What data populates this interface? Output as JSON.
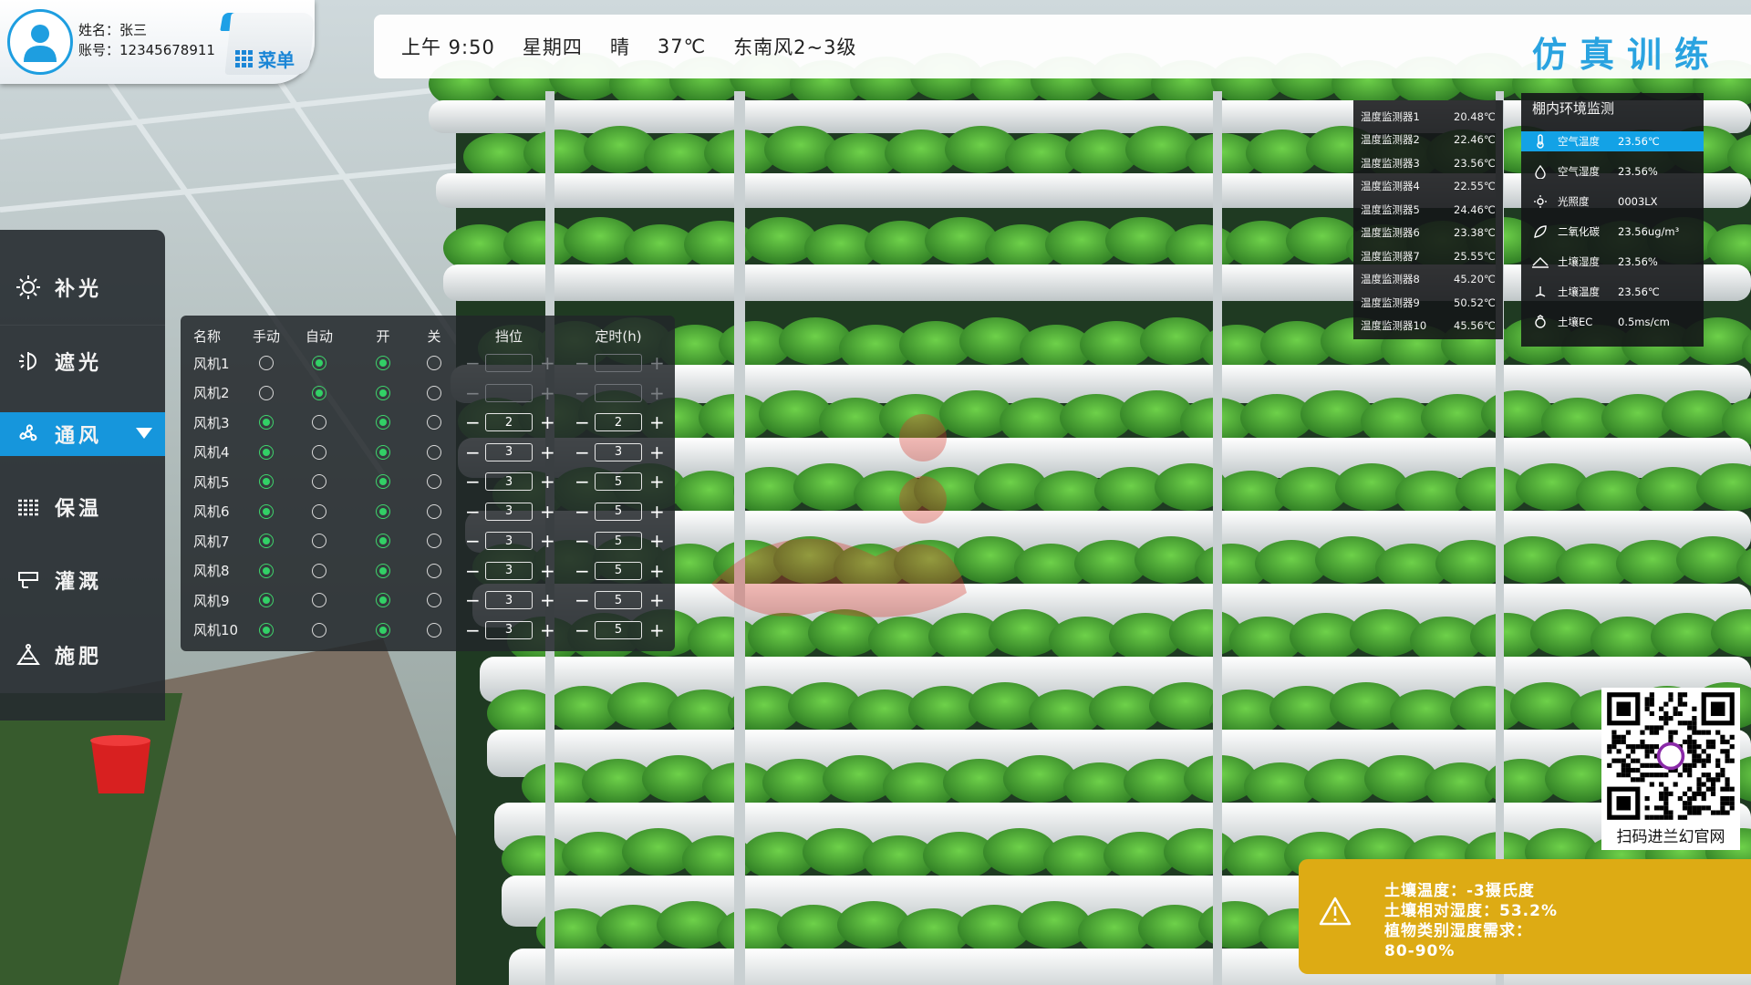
{
  "user": {
    "name_line": "姓名：张三",
    "account_line": "账号：12345678911"
  },
  "menu_label": "菜单",
  "status": {
    "time": "上午 9:50",
    "weekday": "星期四",
    "weather": "晴",
    "temperature": "37℃",
    "wind": "东南风2~3级",
    "mode_title": "仿真训练"
  },
  "nav": {
    "items": [
      {
        "label": "补光",
        "icon": "sun-icon"
      },
      {
        "label": "遮光",
        "icon": "shade-icon"
      },
      {
        "label": "通风",
        "icon": "fan-icon",
        "active": true
      },
      {
        "label": "保温",
        "icon": "insulation-icon"
      },
      {
        "label": "灌溉",
        "icon": "irrigation-icon"
      },
      {
        "label": "施肥",
        "icon": "fertilize-icon"
      }
    ]
  },
  "fan_table": {
    "headers": {
      "name": "名称",
      "manual": "手动",
      "auto": "自动",
      "on": "开",
      "off": "关",
      "gear": "挡位",
      "timer": "定时(h)"
    },
    "rows": [
      {
        "name": "风机1",
        "mode": "auto",
        "power": "on",
        "gear": "",
        "timer": ""
      },
      {
        "name": "风机2",
        "mode": "auto",
        "power": "on",
        "gear": "",
        "timer": ""
      },
      {
        "name": "风机3",
        "mode": "manual",
        "power": "on",
        "gear": "2",
        "timer": "2"
      },
      {
        "name": "风机4",
        "mode": "manual",
        "power": "on",
        "gear": "3",
        "timer": "3"
      },
      {
        "name": "风机5",
        "mode": "manual",
        "power": "on",
        "gear": "3",
        "timer": "5"
      },
      {
        "name": "风机6",
        "mode": "manual",
        "power": "on",
        "gear": "3",
        "timer": "5"
      },
      {
        "name": "风机7",
        "mode": "manual",
        "power": "on",
        "gear": "3",
        "timer": "5"
      },
      {
        "name": "风机8",
        "mode": "manual",
        "power": "on",
        "gear": "3",
        "timer": "5"
      },
      {
        "name": "风机9",
        "mode": "manual",
        "power": "on",
        "gear": "3",
        "timer": "5"
      },
      {
        "name": "风机10",
        "mode": "manual",
        "power": "on",
        "gear": "3",
        "timer": "5"
      }
    ],
    "minus": "−",
    "plus": "+"
  },
  "sensors": [
    {
      "name": "温度监测器1",
      "value": "20.48℃"
    },
    {
      "name": "温度监测器2",
      "value": "22.46℃"
    },
    {
      "name": "温度监测器3",
      "value": "23.56℃"
    },
    {
      "name": "温度监测器4",
      "value": "22.55℃"
    },
    {
      "name": "温度监测器5",
      "value": "24.46℃"
    },
    {
      "name": "温度监测器6",
      "value": "23.38℃"
    },
    {
      "name": "温度监测器7",
      "value": "25.55℃"
    },
    {
      "name": "温度监测器8",
      "value": "45.20℃"
    },
    {
      "name": "温度监测器9",
      "value": "50.52℃"
    },
    {
      "name": "温度监测器10",
      "value": "45.56℃"
    }
  ],
  "env": {
    "title": "棚内环境监测",
    "rows": [
      {
        "name": "空气温度",
        "value": "23.56℃",
        "icon": "thermometer-icon",
        "active": true
      },
      {
        "name": "空气湿度",
        "value": "23.56%",
        "icon": "droplet-icon"
      },
      {
        "name": "光照度",
        "value": "0003LX",
        "icon": "light-icon"
      },
      {
        "name": "二氧化碳",
        "value": "23.56ug/m³",
        "icon": "leaf-icon"
      },
      {
        "name": "土壤湿度",
        "value": "23.56%",
        "icon": "soil-moisture-icon"
      },
      {
        "name": "土壤温度",
        "value": "23.56℃",
        "icon": "soil-temp-icon"
      },
      {
        "name": "土壤EC",
        "value": "0.5ms/cm",
        "icon": "ec-icon"
      }
    ]
  },
  "qr": {
    "caption": "扫码进兰幻官网"
  },
  "alert": {
    "lines": [
      "土壤温度：-3摄氏度",
      "土壤相对湿度：53.2%",
      "植物类别湿度需求：",
      "80-90%"
    ]
  },
  "colors": {
    "accent": "#1696dc",
    "radio_on": "#32d066",
    "alert": "#ddab14",
    "title": "#2aa3e0"
  }
}
